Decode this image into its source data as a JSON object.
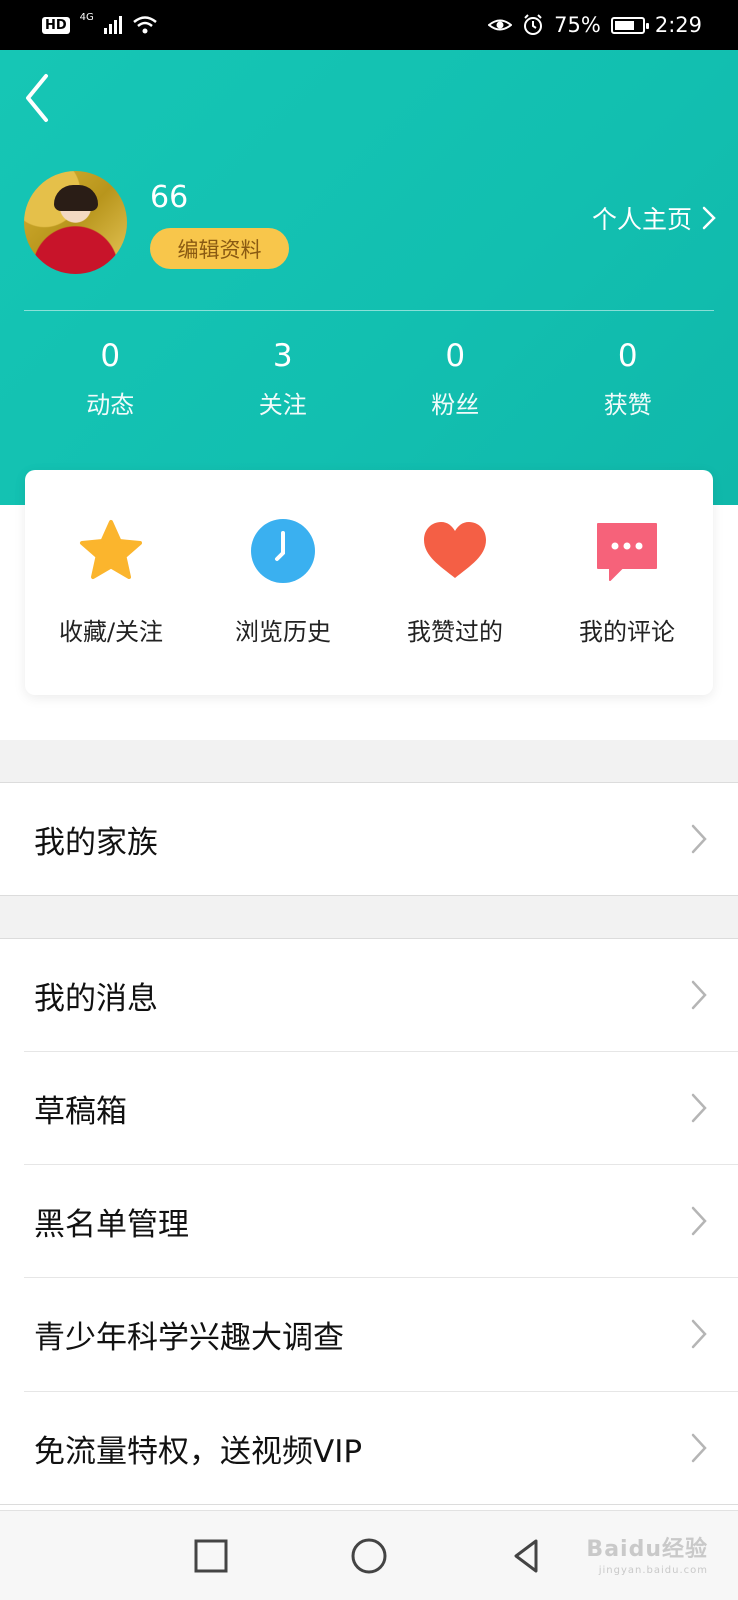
{
  "status_bar": {
    "hd": "HD",
    "network": "4G",
    "battery": "75%",
    "battery_level": 0.75,
    "time": "2:29"
  },
  "profile": {
    "username": "66",
    "edit_label": "编辑资料",
    "homepage_label": "个人主页"
  },
  "stats": [
    {
      "value": "0",
      "label": "动态"
    },
    {
      "value": "3",
      "label": "关注"
    },
    {
      "value": "0",
      "label": "粉丝"
    },
    {
      "value": "0",
      "label": "获赞"
    }
  ],
  "quick_actions": [
    {
      "label": "收藏/关注",
      "icon": "star-icon"
    },
    {
      "label": "浏览历史",
      "icon": "clock-icon"
    },
    {
      "label": "我赞过的",
      "icon": "heart-icon"
    },
    {
      "label": "我的评论",
      "icon": "comment-icon"
    }
  ],
  "menu_groups": {
    "family": {
      "label": "我的家族"
    },
    "items": [
      {
        "label": "我的消息"
      },
      {
        "label": "草稿箱"
      },
      {
        "label": "黑名单管理"
      },
      {
        "label": "青少年科学兴趣大调查"
      },
      {
        "label": "免流量特权，送视频VIP"
      }
    ]
  },
  "watermark": {
    "text": "Baidu经验",
    "sub": "jingyan.baidu.com"
  },
  "colors": {
    "header": "#13c2b3",
    "edit_button": "#f8c64b",
    "star": "#fbb52d",
    "clock": "#3ab0f0",
    "heart": "#f45f45",
    "comment": "#f6627a"
  }
}
